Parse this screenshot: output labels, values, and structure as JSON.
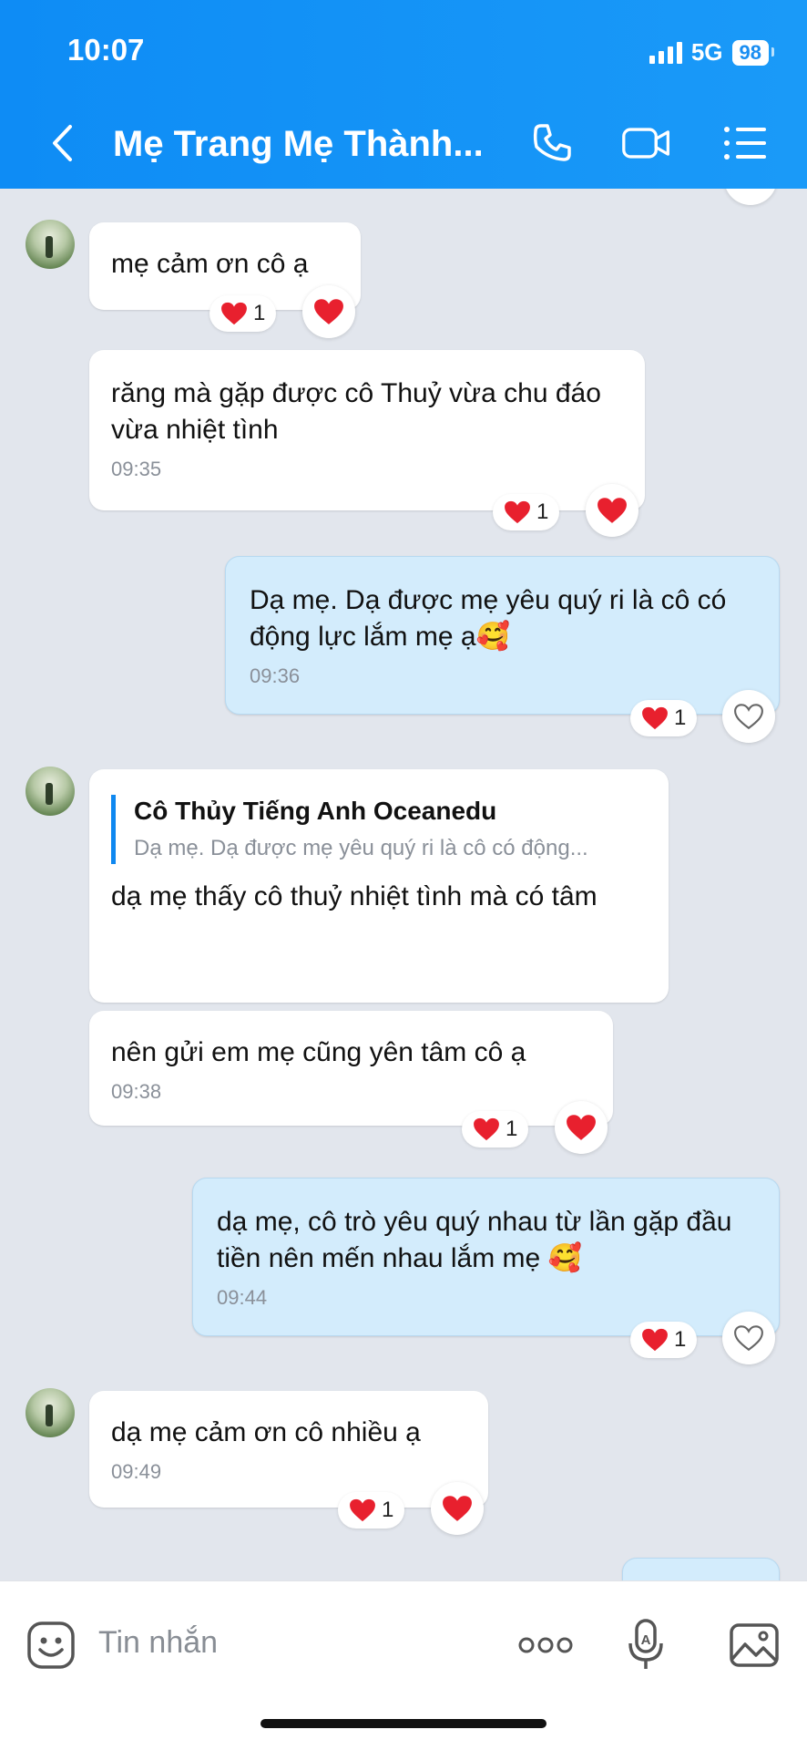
{
  "status": {
    "time": "10:07",
    "network": "5G",
    "battery": "98"
  },
  "header": {
    "title": "Mẹ Trang Mẹ Thành..."
  },
  "messages": [
    {
      "text": "mẹ cảm ơn cô ạ",
      "reaction_count": "1"
    },
    {
      "text": "răng mà gặp được cô Thuỷ vừa chu đáo vừa nhiệt tình",
      "time": "09:35",
      "reaction_count": "1"
    },
    {
      "text": "Dạ mẹ. Dạ được mẹ yêu quý ri là cô có động lực lắm mẹ ạ🥰",
      "time": "09:36",
      "reaction_count": "1"
    },
    {
      "quote_name": "Cô Thủy Tiếng Anh Oceanedu",
      "quote_text": "Dạ mẹ. Dạ được mẹ yêu quý ri là cô có động...",
      "text": "dạ mẹ thấy cô thuỷ nhiệt tình mà có tâm"
    },
    {
      "text": "nên gửi em mẹ cũng yên tâm cô ạ",
      "time": "09:38",
      "reaction_count": "1"
    },
    {
      "text": "dạ mẹ, cô trò yêu quý nhau từ lần gặp đầu tiền nên mến nhau lắm mẹ 🥰",
      "time": "09:44",
      "reaction_count": "1"
    },
    {
      "text": "dạ mẹ cảm ơn cô nhiều ạ",
      "time": "09:49",
      "reaction_count": "1"
    }
  ],
  "input": {
    "placeholder": "Tin nhắn"
  },
  "icons": [
    "back-icon",
    "phone-icon",
    "video-icon",
    "menu-icon",
    "heart-icon",
    "sticker-icon",
    "more-icon",
    "voice-icon",
    "image-icon"
  ],
  "colors": {
    "header": "#1a9af8",
    "mine_bubble": "#d3ecfc",
    "heart": "#e8202e",
    "quote_bar": "#0f88f0"
  }
}
